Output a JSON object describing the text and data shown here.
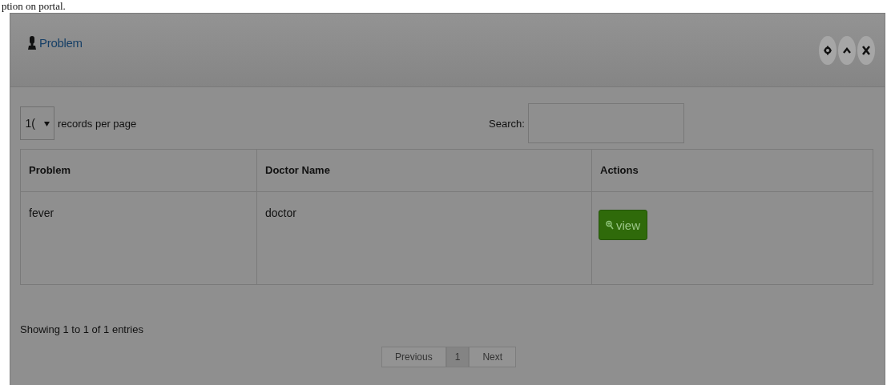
{
  "caption": "ption on portal.",
  "panel": {
    "title": "Problem",
    "header_buttons": [
      {
        "kind": "settings"
      },
      {
        "kind": "collapse"
      },
      {
        "kind": "close"
      }
    ]
  },
  "length_select": {
    "value": "1(",
    "label": "records per page"
  },
  "search": {
    "label": "Search:"
  },
  "table": {
    "columns": [
      "Problem",
      "Doctor Name",
      "Actions"
    ],
    "rows": [
      {
        "cells": [
          "fever",
          "doctor"
        ],
        "action": "view"
      }
    ]
  },
  "info": "Showing 1 to 1 of 1 entries",
  "pagination": [
    {
      "label": "Previous",
      "selected": false
    },
    {
      "label": "1",
      "selected": true
    },
    {
      "label": "Next",
      "selected": false
    }
  ]
}
